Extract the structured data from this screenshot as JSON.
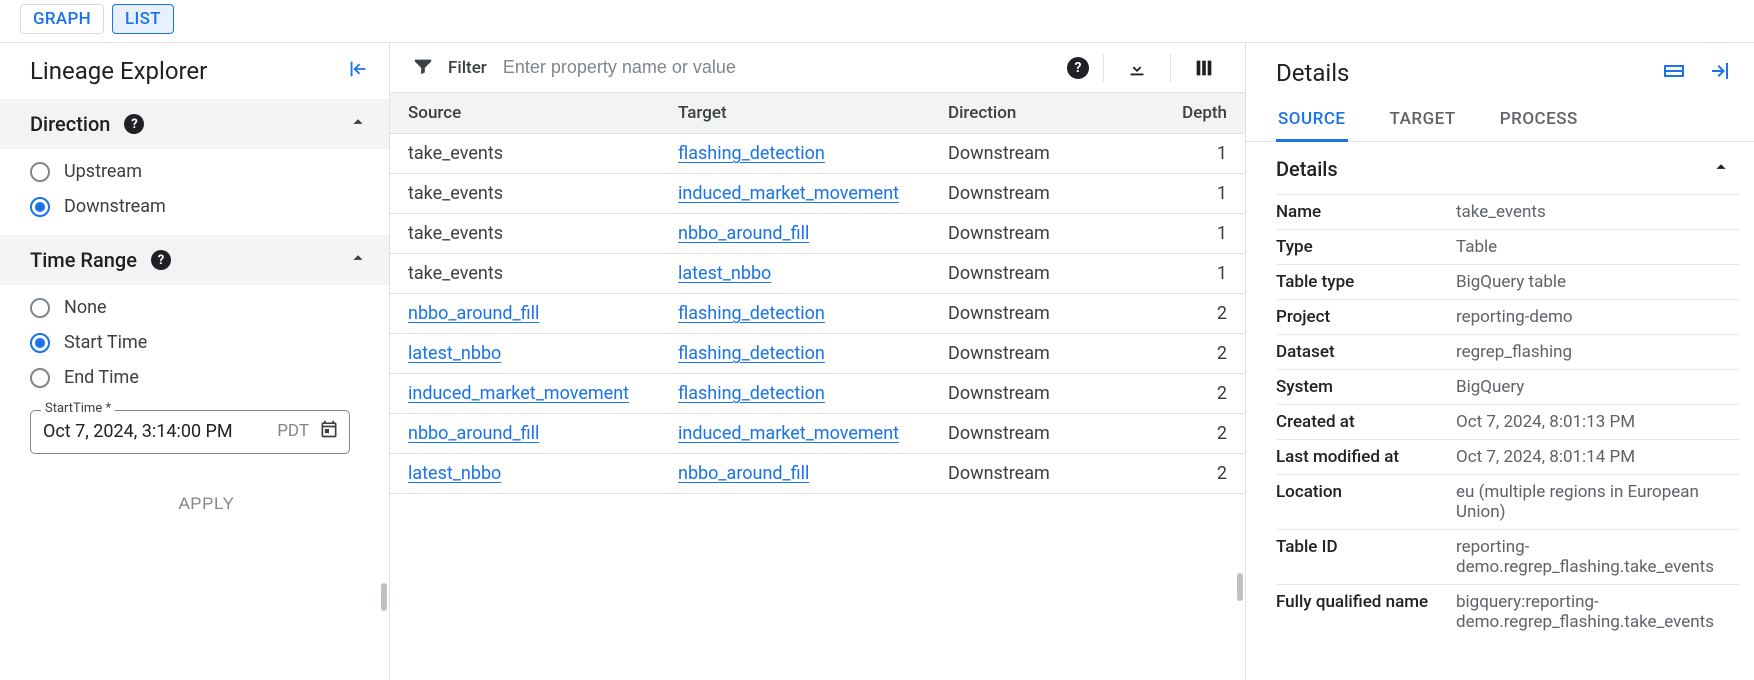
{
  "viewTabs": {
    "graph": "GRAPH",
    "list": "LIST",
    "active": "list"
  },
  "sidebar": {
    "title": "Lineage Explorer",
    "direction": {
      "label": "Direction",
      "options": {
        "upstream": "Upstream",
        "downstream": "Downstream"
      },
      "selected": "downstream"
    },
    "timeRange": {
      "label": "Time Range",
      "options": {
        "none": "None",
        "start": "Start Time",
        "end": "End Time"
      },
      "selected": "start",
      "field": {
        "notch": "StartTime *",
        "value": "Oct 7, 2024, 3:14:00 PM",
        "tz": "PDT"
      }
    },
    "applyLabel": "APPLY"
  },
  "toolbar": {
    "filterLabel": "Filter",
    "placeholder": "Enter property name or value"
  },
  "table": {
    "headers": {
      "source": "Source",
      "target": "Target",
      "direction": "Direction",
      "depth": "Depth"
    },
    "rows": [
      {
        "source": "take_events",
        "sourceLink": false,
        "target": "flashing_detection",
        "direction": "Downstream",
        "depth": "1"
      },
      {
        "source": "take_events",
        "sourceLink": false,
        "target": "induced_market_movement",
        "direction": "Downstream",
        "depth": "1"
      },
      {
        "source": "take_events",
        "sourceLink": false,
        "target": "nbbo_around_fill",
        "direction": "Downstream",
        "depth": "1"
      },
      {
        "source": "take_events",
        "sourceLink": false,
        "target": "latest_nbbo",
        "direction": "Downstream",
        "depth": "1"
      },
      {
        "source": "nbbo_around_fill",
        "sourceLink": true,
        "target": "flashing_detection",
        "direction": "Downstream",
        "depth": "2"
      },
      {
        "source": "latest_nbbo",
        "sourceLink": true,
        "target": "flashing_detection",
        "direction": "Downstream",
        "depth": "2"
      },
      {
        "source": "induced_market_movement",
        "sourceLink": true,
        "target": "flashing_detection",
        "direction": "Downstream",
        "depth": "2"
      },
      {
        "source": "nbbo_around_fill",
        "sourceLink": true,
        "target": "induced_market_movement",
        "direction": "Downstream",
        "depth": "2"
      },
      {
        "source": "latest_nbbo",
        "sourceLink": true,
        "target": "nbbo_around_fill",
        "direction": "Downstream",
        "depth": "2"
      }
    ]
  },
  "details": {
    "title": "Details",
    "tabs": {
      "source": "SOURCE",
      "target": "TARGET",
      "process": "PROCESS",
      "active": "source"
    },
    "sectionLabel": "Details",
    "kv": [
      {
        "k": "Name",
        "v": "take_events"
      },
      {
        "k": "Type",
        "v": "Table"
      },
      {
        "k": "Table type",
        "v": "BigQuery table"
      },
      {
        "k": "Project",
        "v": "reporting-demo"
      },
      {
        "k": "Dataset",
        "v": "regrep_flashing"
      },
      {
        "k": "System",
        "v": "BigQuery"
      },
      {
        "k": "Created at",
        "v": "Oct 7, 2024, 8:01:13 PM"
      },
      {
        "k": "Last modified at",
        "v": "Oct 7, 2024, 8:01:14 PM"
      },
      {
        "k": "Location",
        "v": "eu (multiple regions in European Union)"
      },
      {
        "k": "Table ID",
        "v": "reporting-demo.regrep_flashing.take_events"
      },
      {
        "k": "Fully qualified name",
        "v": "bigquery:reporting-demo.regrep_flashing.take_events"
      }
    ]
  }
}
